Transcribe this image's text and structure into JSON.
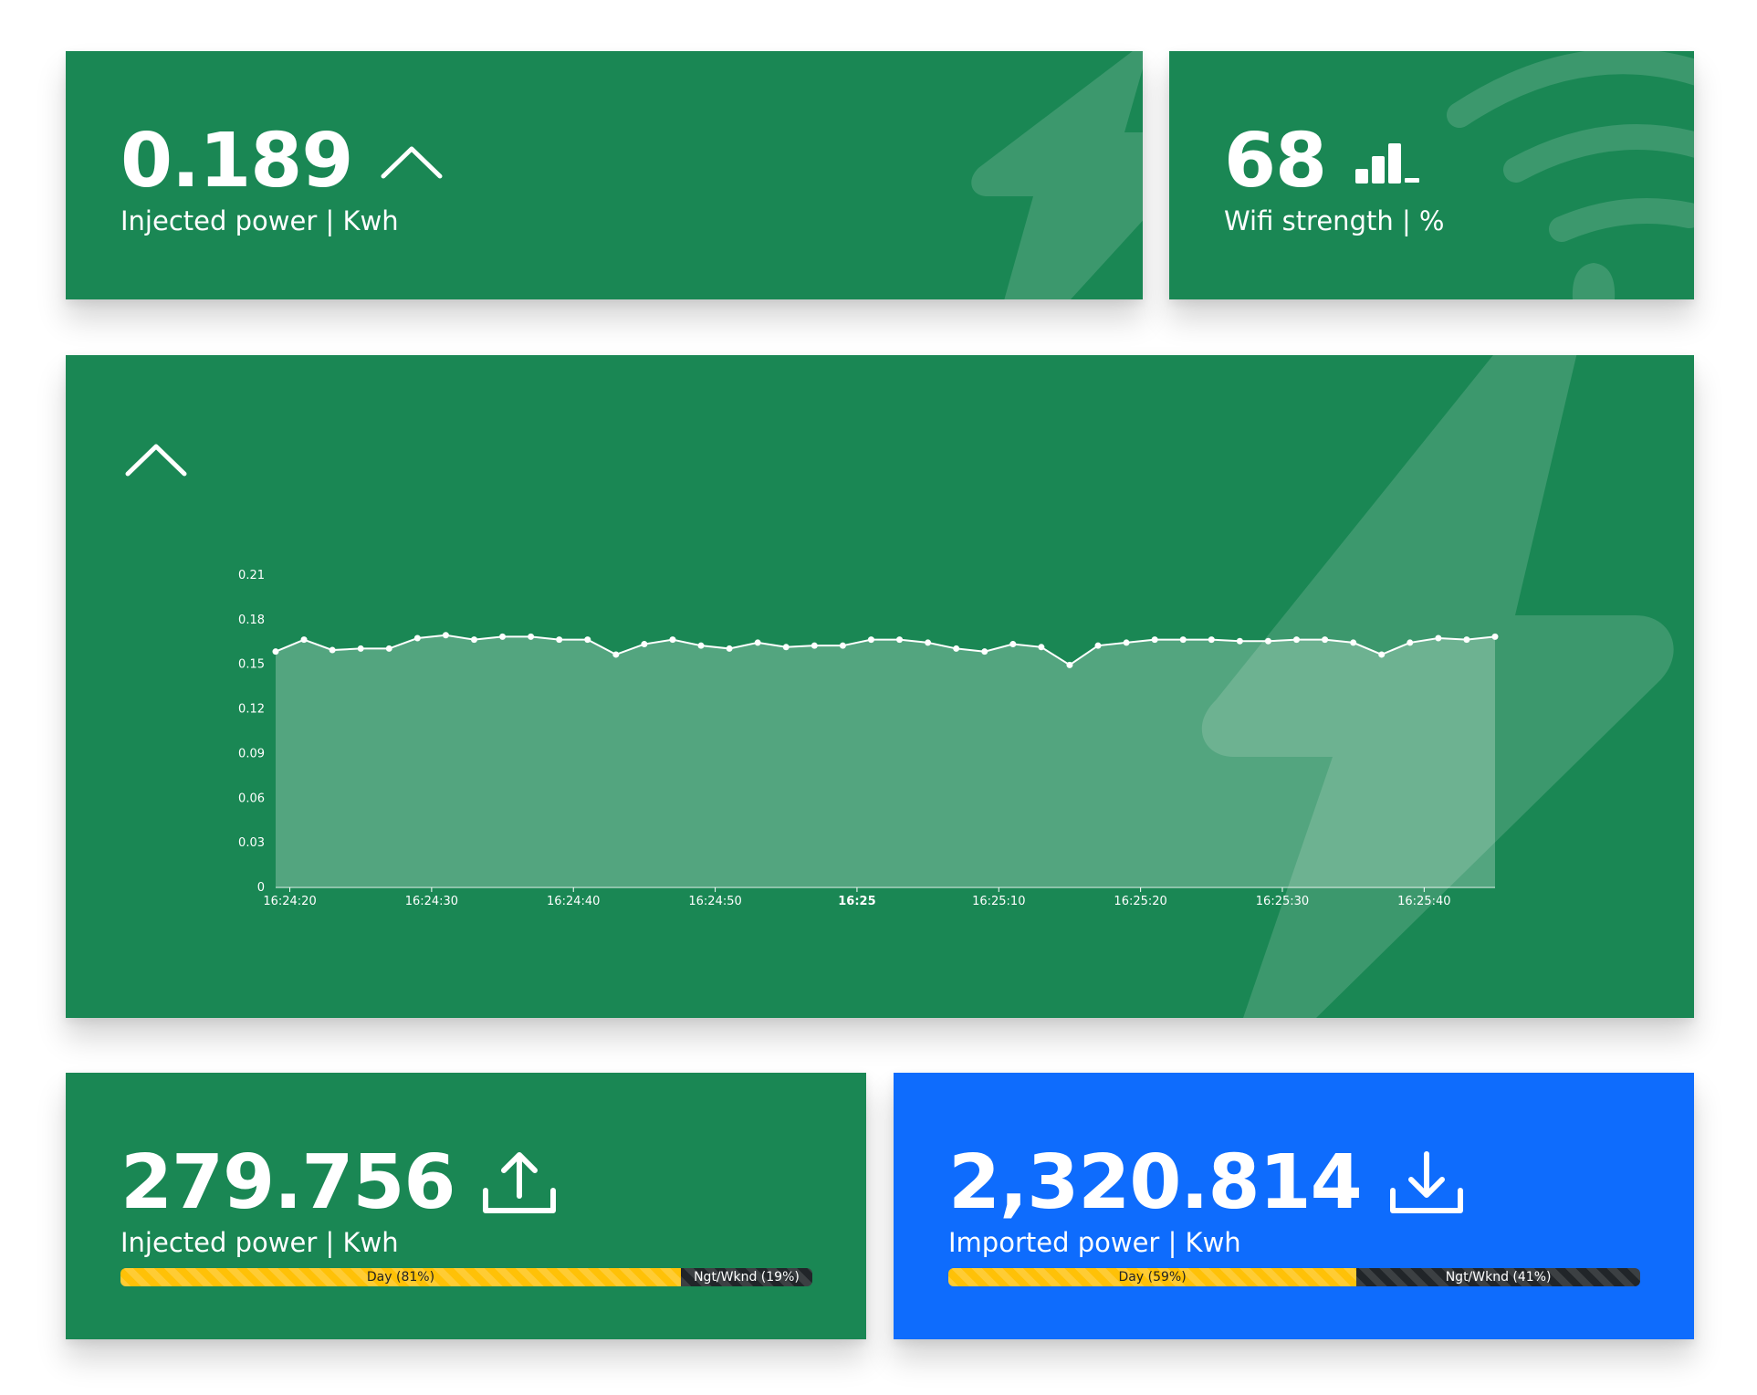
{
  "cards": {
    "injected_live": {
      "value": "0.189",
      "caption": "Injected power | Kwh",
      "trend_icon": "chevron-up-icon",
      "background_icon": "lightning-bolt-icon",
      "color": "#1a8754"
    },
    "wifi": {
      "value": "68",
      "caption": "Wifi strength | %",
      "signal_icon": "signal-bars-icon",
      "background_icon": "wifi-icon",
      "color": "#1a8754"
    },
    "injected_total": {
      "value": "279.756",
      "caption": "Injected power | Kwh",
      "icon": "upload-icon",
      "color": "#1a8754",
      "split": {
        "day_label": "Day (81%)",
        "day_percent": 81,
        "night_label": "Ngt/Wknd (19%)",
        "night_percent": 19
      }
    },
    "imported_total": {
      "value": "2,320.814",
      "caption": "Imported power | Kwh",
      "icon": "download-icon",
      "color": "#0e6cfd",
      "split": {
        "day_label": "Day (59%)",
        "day_percent": 59,
        "night_label": "Ngt/Wknd (41%)",
        "night_percent": 41
      }
    }
  },
  "chart_panel": {
    "toggle_icon": "chevron-up-icon",
    "background_icon": "lightning-bolt-icon"
  },
  "chart_data": {
    "type": "area",
    "title": "",
    "xlabel": "",
    "ylabel": "",
    "ylim": [
      0,
      0.21
    ],
    "yticks": [
      "0",
      "0.03",
      "0.06",
      "0.09",
      "0.12",
      "0.15",
      "0.18",
      "0.21"
    ],
    "xticks": [
      {
        "label": "16:24:20",
        "t": 1,
        "bold": false
      },
      {
        "label": "16:24:30",
        "t": 11,
        "bold": false
      },
      {
        "label": "16:24:40",
        "t": 21,
        "bold": false
      },
      {
        "label": "16:24:50",
        "t": 31,
        "bold": false
      },
      {
        "label": "16:25",
        "t": 41,
        "bold": true
      },
      {
        "label": "16:25:10",
        "t": 51,
        "bold": false
      },
      {
        "label": "16:25:20",
        "t": 61,
        "bold": false
      },
      {
        "label": "16:25:30",
        "t": 71,
        "bold": false
      },
      {
        "label": "16:25:40",
        "t": 81,
        "bold": false
      }
    ],
    "xrange": [
      0,
      86
    ],
    "grid": false,
    "series": [
      {
        "name": "",
        "color": "#ffffff",
        "x": [
          0,
          2,
          4,
          6,
          8,
          10,
          12,
          14,
          16,
          18,
          20,
          22,
          24,
          26,
          28,
          30,
          32,
          34,
          36,
          38,
          40,
          42,
          44,
          46,
          48,
          50,
          52,
          54,
          56,
          58,
          60,
          62,
          64,
          66,
          68,
          70,
          72,
          74,
          76,
          78,
          80,
          82,
          84,
          86
        ],
        "y": [
          0.158,
          0.166,
          0.159,
          0.16,
          0.16,
          0.167,
          0.169,
          0.166,
          0.168,
          0.168,
          0.166,
          0.166,
          0.156,
          0.163,
          0.166,
          0.162,
          0.16,
          0.164,
          0.161,
          0.162,
          0.162,
          0.166,
          0.166,
          0.164,
          0.16,
          0.158,
          0.163,
          0.161,
          0.149,
          0.162,
          0.164,
          0.166,
          0.166,
          0.166,
          0.165,
          0.165,
          0.166,
          0.166,
          0.164,
          0.156,
          0.164,
          0.167,
          0.166,
          0.168
        ]
      }
    ]
  }
}
